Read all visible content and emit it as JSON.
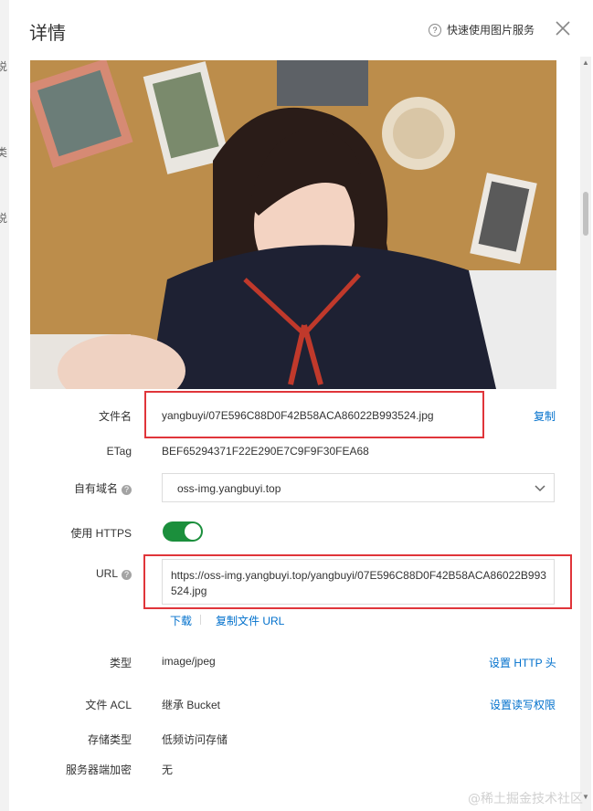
{
  "background_labels": [
    "说",
    "类",
    "说"
  ],
  "header": {
    "title": "详情",
    "help_text": "快速使用图片服务"
  },
  "fields": {
    "filename": {
      "label": "文件名",
      "value": "yangbuyi/07E596C88D0F42B58ACA86022B993524.jpg",
      "action": "复制"
    },
    "etag": {
      "label": "ETag",
      "value": "BEF65294371F22E290E7C9F9F30FEA68"
    },
    "domain": {
      "label": "自有域名",
      "value": "oss-img.yangbuyi.top"
    },
    "https": {
      "label": "使用 HTTPS",
      "enabled": true
    },
    "url": {
      "label": "URL",
      "value": "https://oss-img.yangbuyi.top/yangbuyi/07E596C88D0F42B58ACA86022B993524.jpg",
      "download": "下载",
      "copy_url": "复制文件 URL"
    },
    "type": {
      "label": "类型",
      "value": "image/jpeg",
      "action": "设置 HTTP 头"
    },
    "acl": {
      "label": "文件 ACL",
      "value": "继承 Bucket",
      "action": "设置读写权限"
    },
    "storage": {
      "label": "存储类型",
      "value": "低频访问存储"
    },
    "encryption": {
      "label": "服务器端加密",
      "value": "无"
    }
  },
  "icons": [
    "help-icon",
    "close-icon",
    "question-icon",
    "chevron-down-icon"
  ],
  "colors": {
    "accent": "#0070cc",
    "toggle_on": "#1b8f3c",
    "highlight_box": "#e0353a"
  },
  "watermark": "@稀土掘金技术社区"
}
